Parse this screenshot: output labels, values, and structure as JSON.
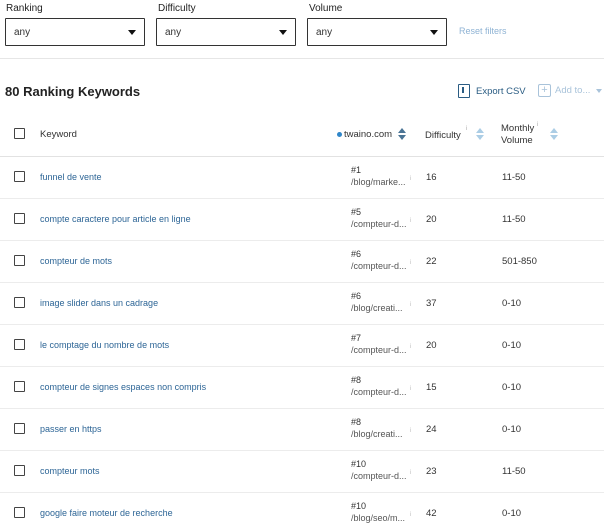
{
  "filters": {
    "ranking": {
      "label": "Ranking",
      "value": "any"
    },
    "difficulty": {
      "label": "Difficulty",
      "value": "any"
    },
    "volume": {
      "label": "Volume",
      "value": "any"
    },
    "reset_label": "Reset filters"
  },
  "heading": "80 Ranking Keywords",
  "actions": {
    "export_label": "Export CSV",
    "addto_label": "Add to..."
  },
  "table": {
    "headers": {
      "keyword": "Keyword",
      "domain": "twaino.com",
      "difficulty": "Difficulty",
      "volume_line1": "Monthly",
      "volume_line2": "Volume",
      "info_glyph": "i"
    },
    "rows": [
      {
        "keyword": "funnel de vente",
        "rank": "#1",
        "url": "/blog/marke...",
        "difficulty": "16",
        "volume": "11-50"
      },
      {
        "keyword": "compte caractere pour article en ligne",
        "rank": "#5",
        "url": "/compteur-d...",
        "difficulty": "20",
        "volume": "11-50"
      },
      {
        "keyword": "compteur de mots",
        "rank": "#6",
        "url": "/compteur-d...",
        "difficulty": "22",
        "volume": "501-850"
      },
      {
        "keyword": "image slider dans un cadrage",
        "rank": "#6",
        "url": "/blog/creati...",
        "difficulty": "37",
        "volume": "0-10"
      },
      {
        "keyword": "le comptage du nombre de mots",
        "rank": "#7",
        "url": "/compteur-d...",
        "difficulty": "20",
        "volume": "0-10"
      },
      {
        "keyword": "compteur de signes espaces non compris",
        "rank": "#8",
        "url": "/compteur-d...",
        "difficulty": "15",
        "volume": "0-10"
      },
      {
        "keyword": "passer en https",
        "rank": "#8",
        "url": "/blog/creati...",
        "difficulty": "24",
        "volume": "0-10"
      },
      {
        "keyword": "compteur mots",
        "rank": "#10",
        "url": "/compteur-d...",
        "difficulty": "23",
        "volume": "11-50"
      },
      {
        "keyword": "google faire moteur de recherche",
        "rank": "#10",
        "url": "/blog/seo/m...",
        "difficulty": "42",
        "volume": "0-10"
      }
    ]
  }
}
